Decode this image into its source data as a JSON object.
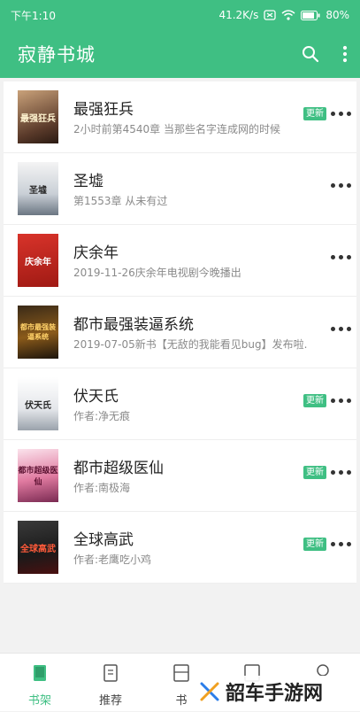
{
  "status": {
    "time": "下午1:10",
    "speed": "41.2K/s",
    "battery": "80%"
  },
  "app": {
    "title": "寂静书城"
  },
  "books": [
    {
      "title": "最强狂兵",
      "subtitle": "2小时前第4540章 当那些名字连成网的时候",
      "badge": "更新"
    },
    {
      "title": "圣墟",
      "subtitle": "第1553章 从未有过",
      "badge": ""
    },
    {
      "title": "庆余年",
      "subtitle": "2019-11-26庆余年电视剧今晚播出",
      "badge": ""
    },
    {
      "title": "都市最强装逼系统",
      "subtitle": "2019-07-05新书【无敌的我能看见bug】发布啦...",
      "badge": ""
    },
    {
      "title": "伏天氏",
      "subtitle": "作者:净无痕",
      "badge": "更新"
    },
    {
      "title": "都市超级医仙",
      "subtitle": "作者:南极海",
      "badge": "更新"
    },
    {
      "title": "全球高武",
      "subtitle": "作者:老鹰吃小鸡",
      "badge": "更新"
    }
  ],
  "covers": [
    "最强狂兵",
    "圣墟",
    "庆余年",
    "都市最强装逼系统",
    "伏天氏",
    "都市超级医仙",
    "全球高武"
  ],
  "tabs": [
    {
      "label": "书架"
    },
    {
      "label": "推荐"
    },
    {
      "label": "书"
    },
    {
      "label": ""
    },
    {
      "label": ""
    }
  ],
  "watermark": "韶车手游网",
  "colors": {
    "accent": "#3fbf83"
  }
}
